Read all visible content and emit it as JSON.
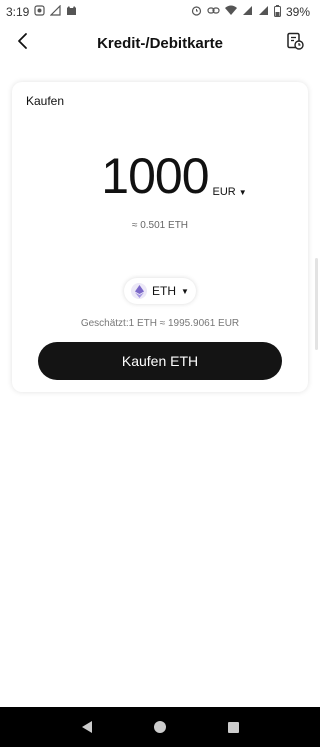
{
  "status_bar": {
    "time": "3:19",
    "battery": "39%"
  },
  "header": {
    "title": "Kredit-/Debitkarte",
    "back_icon": "chevron-left-icon",
    "history_icon": "order-history-icon"
  },
  "purchase": {
    "section_label": "Kaufen",
    "amount": "1000",
    "fiat_currency": "EUR",
    "crypto_estimate": "≈ 0.501 ETH",
    "crypto_currency": "ETH",
    "rate_text": "Geschätzt:1 ETH ≈ 1995.9061 EUR",
    "buy_label": "Kaufen ETH"
  },
  "colors": {
    "button_bg": "#141414",
    "eth_logo": "#7b68c8"
  }
}
